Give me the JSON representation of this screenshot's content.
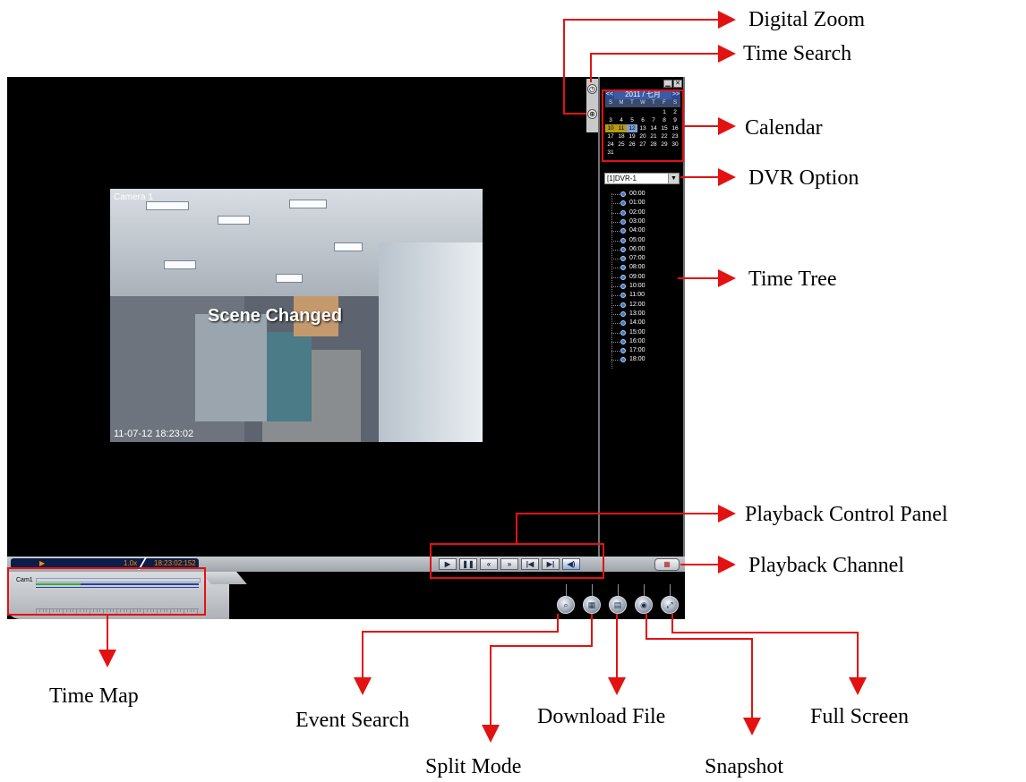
{
  "video": {
    "camera_label": "Camera 1",
    "overlay_text": "Scene Changed",
    "timestamp": "11-07-12 18:23:02"
  },
  "calendar": {
    "header": "2011 / 七月",
    "prev": "<<",
    "next": ">>",
    "weekdays": [
      "S",
      "M",
      "T",
      "W",
      "T",
      "F",
      "S"
    ],
    "record_dates": [
      "10",
      "11"
    ],
    "selected_date": "12"
  },
  "dvr_option": {
    "selected": "[1]DVR-1"
  },
  "time_tree": {
    "hours": [
      "00:00",
      "01:00",
      "02:00",
      "03:00",
      "04:00",
      "05:00",
      "06:00",
      "07:00",
      "08:00",
      "09:00",
      "10:00",
      "11:00",
      "12:00",
      "13:00",
      "14:00",
      "15:00",
      "16:00",
      "17:00",
      "18:00"
    ]
  },
  "status_bar": {
    "speed": "1.0x",
    "time": "18:23:02:152"
  },
  "timemap": {
    "channel": "Cam1"
  },
  "annotations": {
    "digital_zoom": "Digital Zoom",
    "time_search": "Time Search",
    "calendar": "Calendar",
    "dvr_option": "DVR Option",
    "time_tree": "Time Tree",
    "playback_control_panel": "Playback Control Panel",
    "playback_channel": "Playback Channel",
    "time_map": "Time Map",
    "event_search": "Event Search",
    "split_mode": "Split Mode",
    "download_file": "Download File",
    "snapshot": "Snapshot",
    "full_screen": "Full Screen"
  },
  "colors": {
    "annotation_red": "#e31212",
    "status_text": "#ff8c00",
    "record_day": "#b79b17",
    "selected_day": "#7fa2d9"
  },
  "icons": {
    "time_search": "clock-icon",
    "digital_zoom": "zoom-icon",
    "playback": [
      "play-icon",
      "pause-icon",
      "rewind-icon",
      "fast-forward-icon",
      "previous-frame-icon",
      "next-frame-icon",
      "audio-icon"
    ],
    "tools": [
      "event-search-icon",
      "split-mode-icon",
      "download-file-icon",
      "snapshot-icon",
      "full-screen-icon"
    ]
  }
}
